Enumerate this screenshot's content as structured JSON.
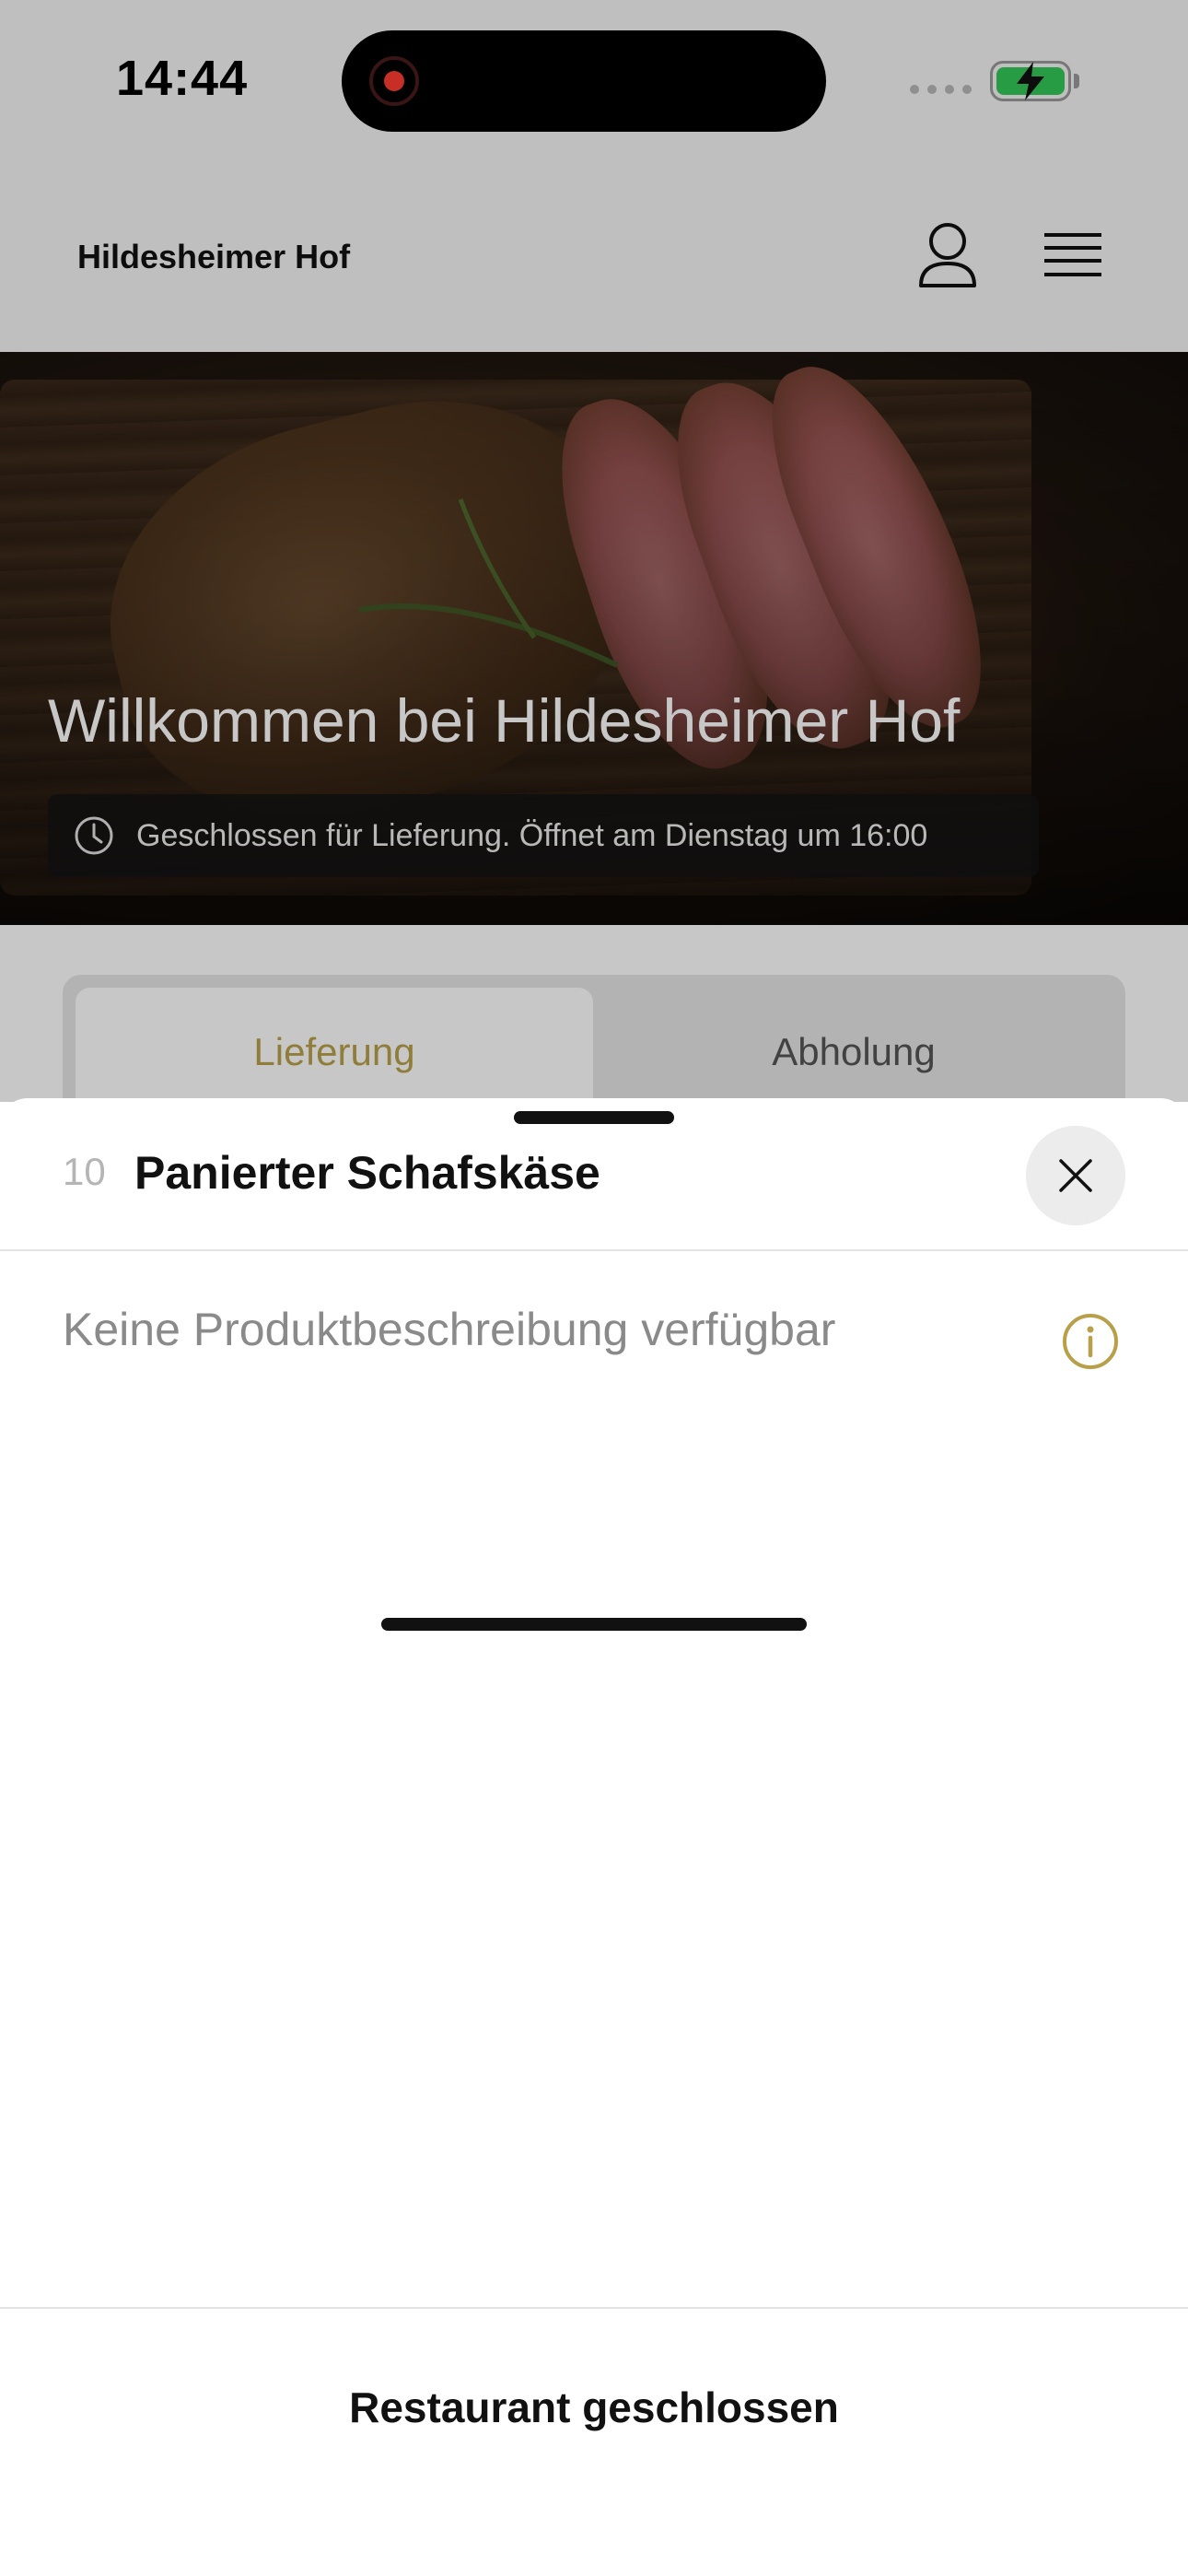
{
  "status_bar": {
    "time": "14:44"
  },
  "header": {
    "title": "Hildesheimer Hof",
    "icons": [
      "user-icon",
      "menu-icon"
    ]
  },
  "hero": {
    "title": "Willkommen bei Hildesheimer Hof",
    "status": "Geschlossen für Lieferung. Öffnet am Dienstag um 16:00",
    "status_icon": "clock-icon"
  },
  "order_tabs": {
    "delivery": "Lieferung",
    "pickup": "Abholung",
    "active": "delivery"
  },
  "product_sheet": {
    "number": "10",
    "title": "Panierter Schafskäse",
    "description": "Keine Produktbeschreibung verfügbar",
    "close_icon": "close-icon",
    "info_icon": "info-icon",
    "footer_button": "Restaurant geschlossen"
  },
  "colors": {
    "accent": "#b8a04a",
    "battery": "#34c759",
    "recording": "#ff3b30"
  }
}
